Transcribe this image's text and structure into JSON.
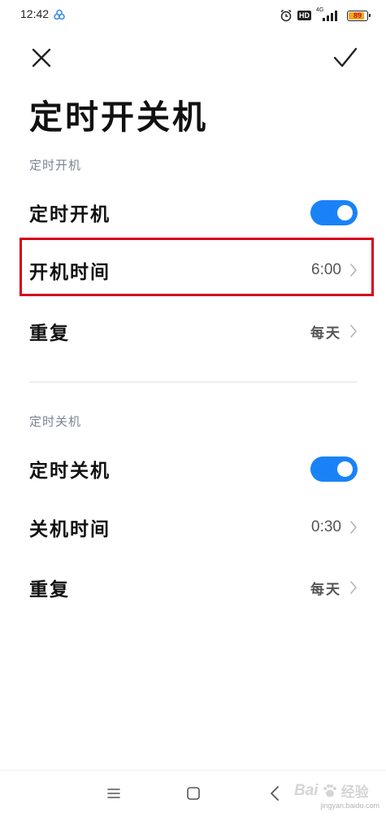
{
  "status_bar": {
    "time": "12:42",
    "hd_badge": "HD",
    "network": "4G",
    "battery_text": "89",
    "battery_level": 0.89,
    "icons": [
      "cloud-app-icon",
      "alarm-icon",
      "signal-icon",
      "battery-icon"
    ]
  },
  "header": {
    "close_icon": "close-icon",
    "confirm_icon": "check-icon",
    "title": "定时开关机"
  },
  "power_on": {
    "section_title": "定时开机",
    "toggle_label": "定时开机",
    "toggle_on": true,
    "time_label": "开机时间",
    "time_value": "6:00",
    "repeat_label": "重复",
    "repeat_value": "每天"
  },
  "power_off": {
    "section_title": "定时关机",
    "toggle_label": "定时关机",
    "toggle_on": true,
    "time_label": "关机时间",
    "time_value": "0:30",
    "repeat_label": "重复",
    "repeat_value": "每天"
  },
  "colors": {
    "accent": "#1a82f7",
    "highlight": "#d6001c",
    "section_header": "#7a8494"
  },
  "nav_bar": {
    "icons": [
      "menu-icon",
      "home-icon",
      "back-icon"
    ]
  },
  "watermark": {
    "logo": "Bai",
    "jingyan": "经验",
    "url": "jingyan.baidu.com"
  }
}
